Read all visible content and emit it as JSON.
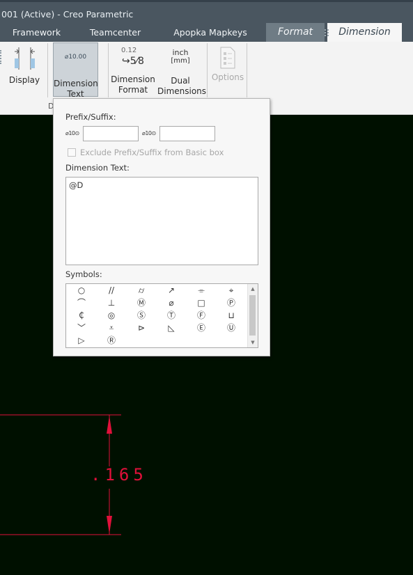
{
  "window": {
    "title": "001 (Active) - Creo Parametric"
  },
  "tabs": [
    {
      "label": "Framework"
    },
    {
      "label": "Teamcenter"
    },
    {
      "label": "Apopka Mapkeys"
    },
    {
      "label": "Format"
    },
    {
      "label": "Dimension"
    }
  ],
  "ribbon": {
    "display_label": "Display",
    "dimension_text": {
      "line1": "Dimension",
      "line2": "Text",
      "icon_text": "⌀10.00"
    },
    "dimension_format": {
      "line1": "Dimension",
      "line2": "Format",
      "icon_top": "0.12",
      "icon_bottom": "↪5⁄8"
    },
    "dual_dimensions": {
      "line1": "Dual",
      "line2": "Dimensions",
      "icon_top": "inch",
      "icon_bottom": "[mm]"
    },
    "options_label": "Options",
    "group_label": "D"
  },
  "popup": {
    "prefix_suffix_label": "Prefix/Suffix:",
    "prefix_icon": "⌀10⊙",
    "suffix_icon": "⌀10⊙",
    "prefix_value": "",
    "suffix_value": "",
    "exclude_label": "Exclude Prefix/Suffix from Basic box",
    "dimension_text_label": "Dimension Text:",
    "dimension_text_value": "@D",
    "symbols_label": "Symbols:",
    "symbols": [
      [
        "○",
        "//",
        "⌭",
        "↗",
        "⌯",
        "⌖"
      ],
      [
        "⌒",
        "⊥",
        "Ⓜ",
        "⌀",
        "□",
        "Ⓟ"
      ],
      [
        "₵",
        "◎",
        "Ⓢ",
        "Ⓣ",
        "Ⓕ",
        "⊔"
      ],
      [
        "﹀",
        "⩡",
        "⊳",
        "◺",
        "Ⓔ",
        "Ⓤ"
      ],
      [
        "▷",
        "Ⓡ"
      ]
    ]
  },
  "drawing": {
    "dimension_value": ".165",
    "color": "#e0103a"
  }
}
